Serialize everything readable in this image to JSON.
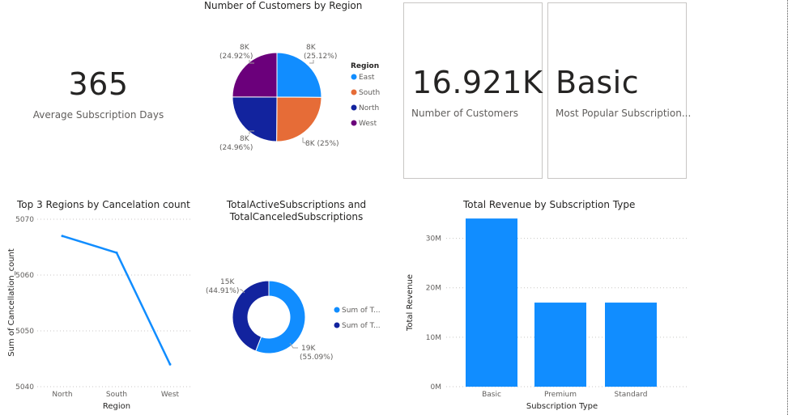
{
  "kpis": {
    "avg_subscription_days": {
      "value": "365",
      "label": "Average Subscription Days"
    },
    "number_of_customers": {
      "value": "16.921K",
      "label": "Number of Customers"
    },
    "most_popular_subscription": {
      "value": "Basic",
      "label": "Most Popular Subscription..."
    }
  },
  "colors": {
    "blue": "#118dff",
    "orange": "#e66c37",
    "navy": "#12239e",
    "purple": "#6b007b"
  },
  "chart_data": [
    {
      "id": "customers_by_region",
      "type": "pie",
      "title": "Number of Customers by Region",
      "legend_title": "Region",
      "legend_position": "right",
      "categories": [
        "East",
        "South",
        "North",
        "West"
      ],
      "values": [
        25.12,
        25,
        24.96,
        24.92
      ],
      "data_labels": [
        "8K",
        "8K",
        "8K",
        "8K"
      ],
      "percent_labels": [
        "(25.12%)",
        "8K (25%)",
        "(24.96%)",
        "(24.92%)"
      ]
    },
    {
      "id": "top3_regions_cancellation",
      "type": "line",
      "title": "Top 3 Regions by Cancelation count",
      "xlabel": "Region",
      "ylabel": "Sum of Cancellation_count",
      "categories": [
        "North",
        "South",
        "West"
      ],
      "values": [
        5067,
        5064,
        5044
      ],
      "ylim": [
        5040,
        5070
      ],
      "yticks": [
        "5070",
        "5060",
        "5050",
        "5040"
      ],
      "grid": true
    },
    {
      "id": "active_vs_canceled",
      "type": "pie",
      "subtype": "donut",
      "title_lines": [
        "TotalActiveSubscriptions and",
        "TotalCanceledSubscriptions"
      ],
      "legend_position": "right",
      "categories": [
        "Sum of T...",
        "Sum of T..."
      ],
      "values": [
        19,
        15
      ],
      "data_labels": [
        "19K",
        "15K"
      ],
      "percent_labels": [
        "(55.09%)",
        "(44.91%)"
      ]
    },
    {
      "id": "revenue_by_subscription",
      "type": "bar",
      "title": "Total Revenue by Subscription Type",
      "xlabel": "Subscription Type",
      "ylabel": "Total Revenue",
      "categories": [
        "Basic",
        "Premium",
        "Standard"
      ],
      "values": [
        34,
        17,
        17
      ],
      "ylim": [
        0,
        35
      ],
      "yticks": [
        "30M",
        "20M",
        "10M",
        "0M"
      ],
      "grid": true
    }
  ]
}
